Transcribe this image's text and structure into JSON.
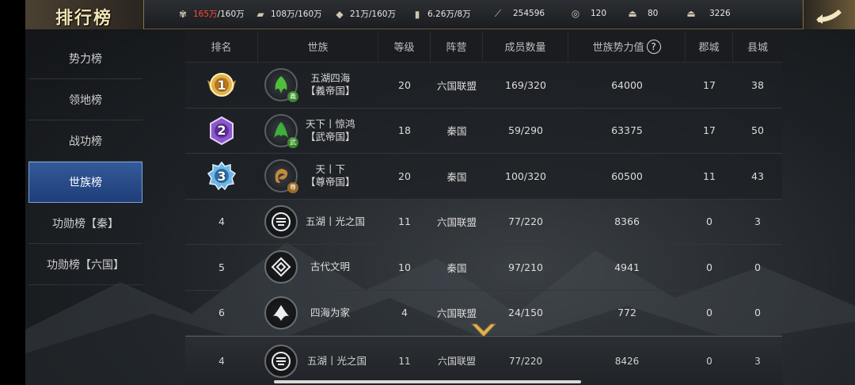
{
  "header": {
    "title": "排行榜",
    "resources": [
      {
        "icon": "grain-icon",
        "value_warn": "165万",
        "value_rest": "/160万"
      },
      {
        "icon": "wood-icon",
        "value_warn": "",
        "value_rest": "108万/160万"
      },
      {
        "icon": "stone-icon",
        "value_warn": "",
        "value_rest": "21万/160万"
      },
      {
        "icon": "iron-icon",
        "value_warn": "",
        "value_rest": "6.26万/8万"
      },
      {
        "icon": "copper-icon",
        "value_warn": "",
        "value_rest": "254596"
      },
      {
        "icon": "coin-icon",
        "value_warn": "",
        "value_rest": "120"
      },
      {
        "icon": "gold-ingot-icon",
        "value_warn": "",
        "value_rest": "80"
      },
      {
        "icon": "silver-ingot-icon",
        "value_warn": "",
        "value_rest": "3226"
      }
    ]
  },
  "sidebar": {
    "items": [
      {
        "label": "势力榜",
        "active": false
      },
      {
        "label": "领地榜",
        "active": false
      },
      {
        "label": "战功榜",
        "active": false
      },
      {
        "label": "世族榜",
        "active": true
      },
      {
        "label": "功勋榜【秦】",
        "active": false
      },
      {
        "label": "功勋榜【六国】",
        "active": false
      }
    ]
  },
  "table": {
    "headers": {
      "rank": "排名",
      "clan": "世族",
      "level": "等级",
      "camp": "阵营",
      "members": "成员数量",
      "power": "世族势力值",
      "help": "?",
      "commanderies": "郡城",
      "counties": "县城"
    },
    "rows": [
      {
        "rank": "1",
        "name_line1": "五湖四海",
        "name_line2": "【義帝国】",
        "badge": "義",
        "level": "20",
        "camp": "六国联盟",
        "members": "169/320",
        "power": "64000",
        "commanderies": "17",
        "counties": "38"
      },
      {
        "rank": "2",
        "name_line1": "天下丨惊鸿",
        "name_line2": "【武帝国】",
        "badge": "武",
        "level": "18",
        "camp": "秦国",
        "members": "59/290",
        "power": "63375",
        "commanderies": "17",
        "counties": "50"
      },
      {
        "rank": "3",
        "name_line1": "天丨下",
        "name_line2": "【尊帝国】",
        "badge": "尊",
        "level": "20",
        "camp": "秦国",
        "members": "100/320",
        "power": "60500",
        "commanderies": "11",
        "counties": "43"
      },
      {
        "rank": "4",
        "name_line1": "五湖丨光之国",
        "name_line2": "",
        "badge": "",
        "level": "11",
        "camp": "六国联盟",
        "members": "77/220",
        "power": "8366",
        "commanderies": "0",
        "counties": "3"
      },
      {
        "rank": "5",
        "name_line1": "古代文明",
        "name_line2": "",
        "badge": "",
        "level": "10",
        "camp": "秦国",
        "members": "97/210",
        "power": "4941",
        "commanderies": "0",
        "counties": "0"
      },
      {
        "rank": "6",
        "name_line1": "四海为家",
        "name_line2": "",
        "badge": "",
        "level": "4",
        "camp": "六国联盟",
        "members": "24/150",
        "power": "772",
        "commanderies": "0",
        "counties": "0"
      }
    ],
    "own_row": {
      "rank": "4",
      "name": "五湖丨光之国",
      "level": "11",
      "camp": "六国联盟",
      "members": "77/220",
      "power": "8426",
      "commanderies": "0",
      "counties": "3"
    }
  },
  "colors": {
    "accent": "#2f5aa0",
    "warn": "#ff4a3a",
    "gold": "#e0b255"
  }
}
